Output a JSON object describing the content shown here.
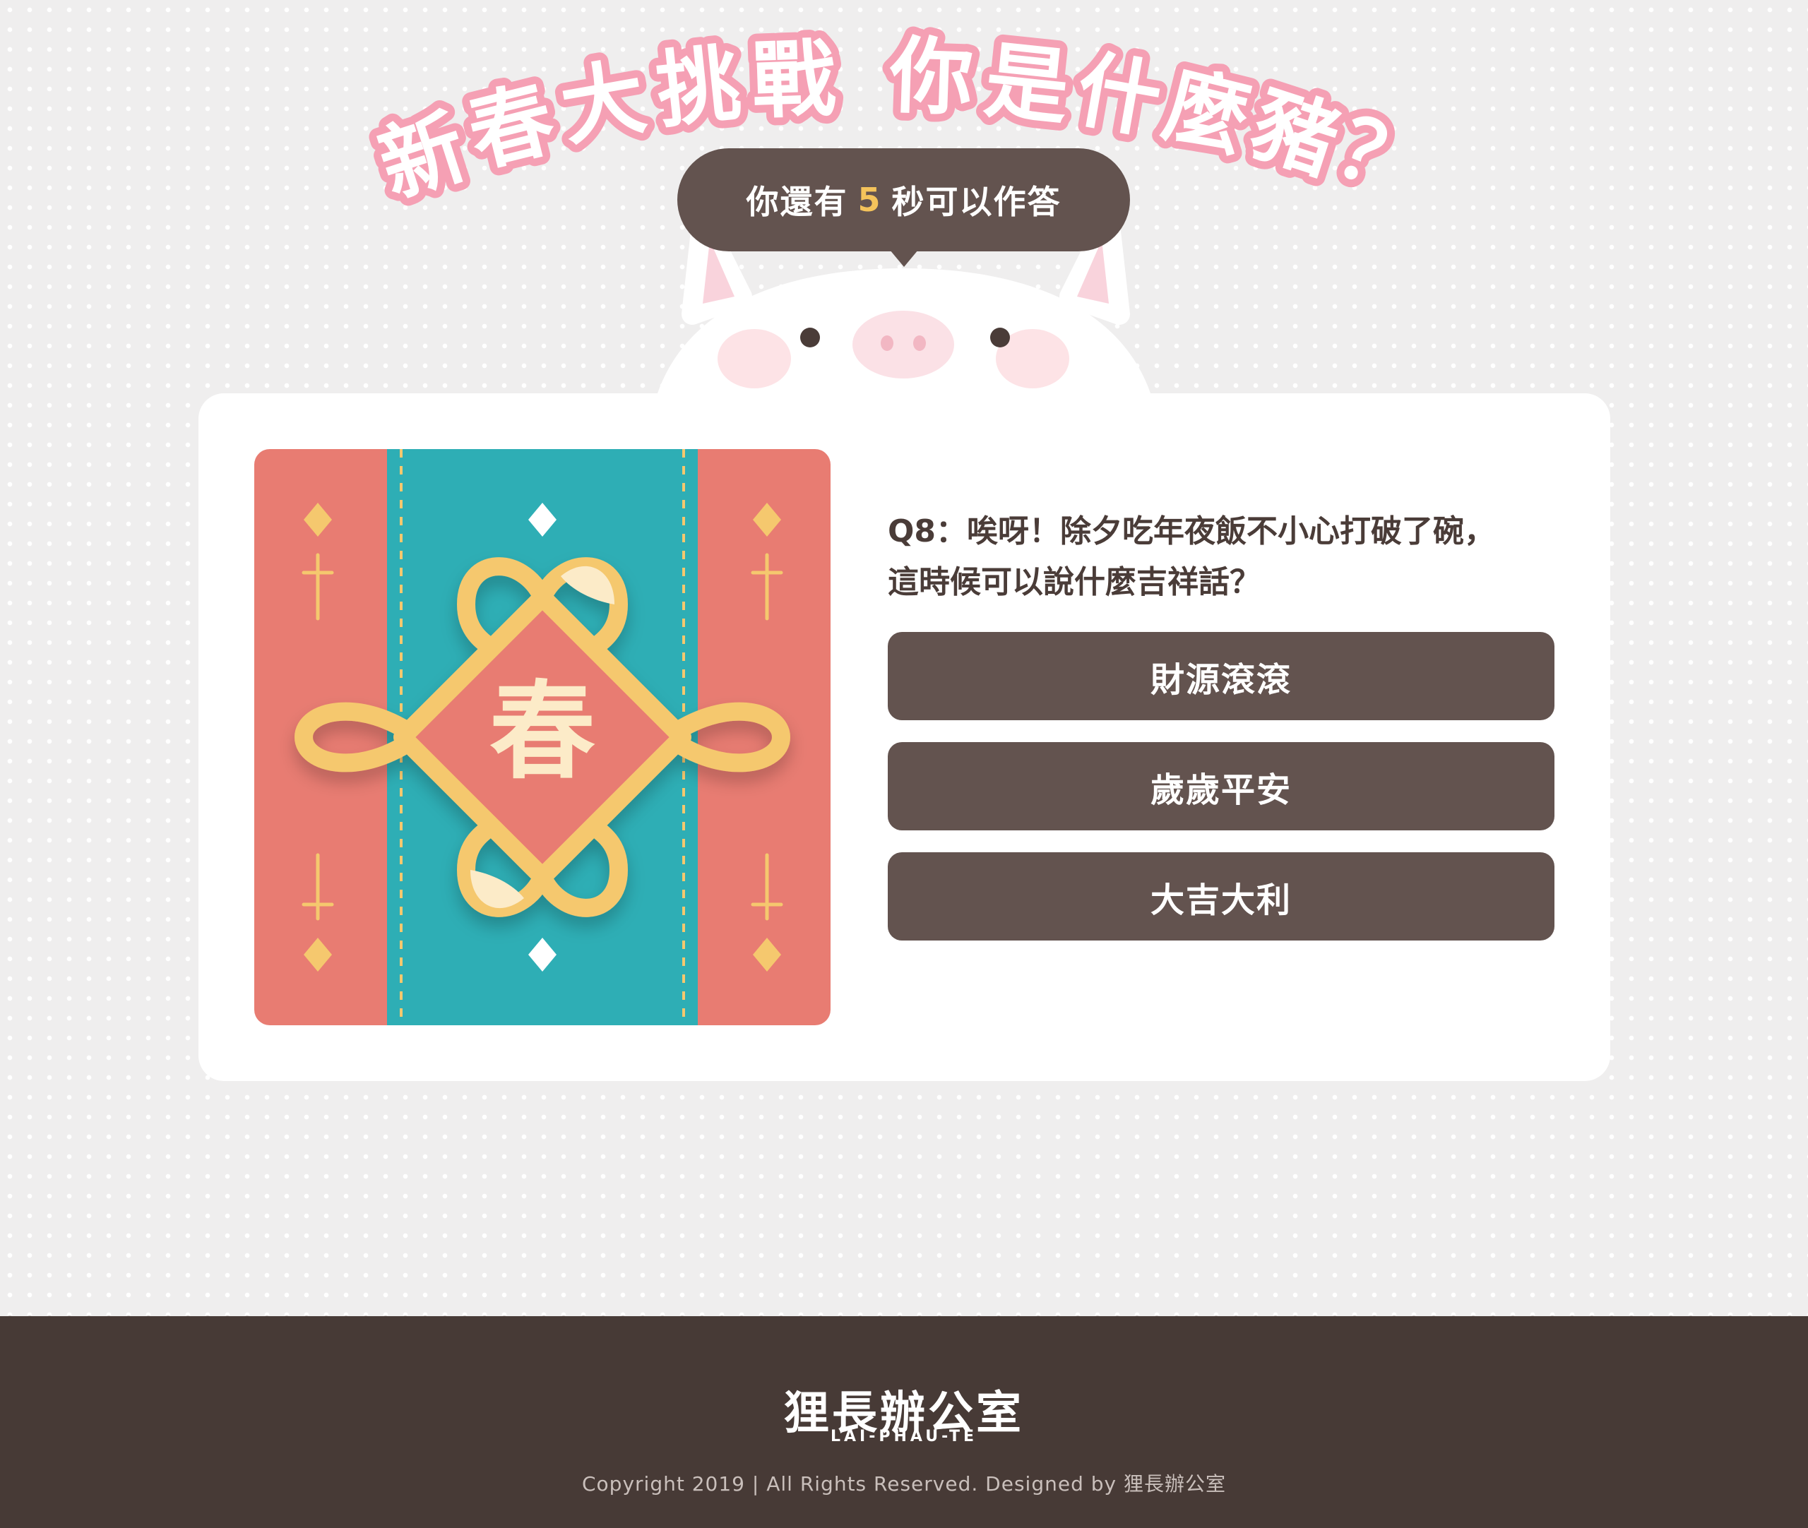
{
  "title": {
    "line1": [
      "新",
      "春",
      "大",
      "挑",
      "戰"
    ],
    "line2": [
      "你",
      "是",
      "什",
      "麼",
      "豬",
      "？"
    ]
  },
  "timer": {
    "prefix": "你還有",
    "seconds": "5",
    "suffix": "秒可以作答"
  },
  "quiz": {
    "illustration_char": "春",
    "question_line1": "Q8：唉呀！除夕吃年夜飯不小心打破了碗，",
    "question_line2": "這時候可以說什麼吉祥話？",
    "answers": [
      "財源滾滾",
      "歲歲平安",
      "大吉大利"
    ]
  },
  "footer": {
    "logo": "狸長辦公室",
    "logo_sub": "LAI-PHAU-TE",
    "copyright": "Copyright 2019 | All Rights Reserved. Designed by 狸長辦公室"
  },
  "colors": {
    "background": "#efeeee",
    "brown": "#63534f",
    "footer": "#473a36",
    "title_outline": "#f5a0b4",
    "coral": "#e87c72",
    "teal": "#2eaeb5",
    "gold": "#f5c86e",
    "timer_number": "#f4c35b"
  }
}
